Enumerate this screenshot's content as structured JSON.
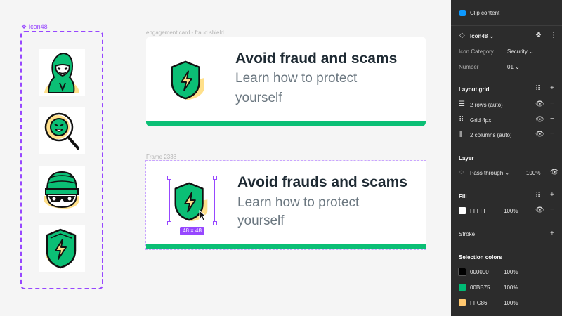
{
  "canvas": {
    "component_label": "Icon48",
    "frame1_label": "engagement card - fraud shield",
    "frame2_label": "Frame 2338",
    "card1": {
      "title": "Avoid fraud and scams",
      "subtitle_line1": "Learn how to protect",
      "subtitle_line2": "yourself"
    },
    "card2": {
      "title": "Avoid frauds and scams",
      "subtitle_line1": "Learn how to protect",
      "subtitle_line2": "yourself"
    },
    "selection_size": "48 × 48",
    "icons": [
      "hacker-icon",
      "search-face-icon",
      "burglar-icon",
      "shield-bolt-icon"
    ]
  },
  "panel": {
    "clip_content": "Clip content",
    "component": {
      "name": "Icon48",
      "category_label": "Icon Category",
      "category_value": "Security",
      "number_label": "Number",
      "number_value": "01"
    },
    "layout_grid": {
      "title": "Layout grid",
      "items": [
        "2 rows (auto)",
        "Grid 4px",
        "2 columns (auto)"
      ]
    },
    "layer": {
      "title": "Layer",
      "blend": "Pass through",
      "opacity": "100%"
    },
    "fill": {
      "title": "Fill",
      "hex": "FFFFFF",
      "opacity": "100%"
    },
    "stroke": {
      "title": "Stroke"
    },
    "selection_colors": {
      "title": "Selection colors",
      "items": [
        {
          "hex": "000000",
          "opacity": "100%",
          "color": "#000000"
        },
        {
          "hex": "00BB75",
          "opacity": "100%",
          "color": "#00bb75"
        },
        {
          "hex": "FFC86F",
          "opacity": "100%",
          "color": "#ffc86f"
        }
      ]
    }
  },
  "colors": {
    "accent": "#9747ff",
    "green": "#0bbf75",
    "yellow": "#ffe08a",
    "panel_bg": "#2c2c2c"
  }
}
